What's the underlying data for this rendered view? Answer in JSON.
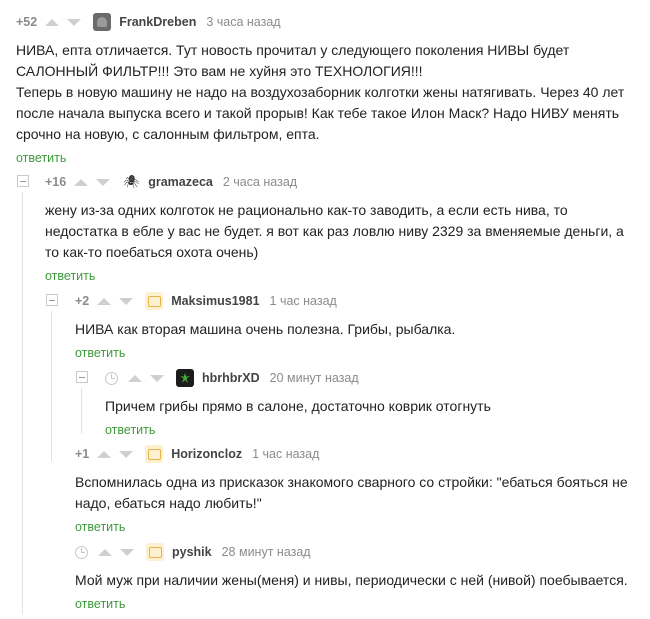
{
  "reply_label": "ответить",
  "colors": {
    "reply": "#3d9a3a",
    "muted": "#8b8b8b",
    "text": "#222222"
  },
  "comments": [
    {
      "rating": "+52",
      "author": "FrankDreben",
      "time": "3 часа назад",
      "avatar": "avatar-photo",
      "text": "НИВА, епта отличается. Тут новость прочитал у следующего поколения НИВЫ будет САЛОННЫЙ ФИЛЬТР!!! Это вам не хуйня это ТЕХНОЛОГИЯ!!!\nТеперь в новую машину не надо на воздухозаборник  колготки жены натягивать. Через 40 лет после начала выпуска всего и такой прорыв! Как тебе такое Илон Маск? Надо НИВУ менять срочно на новую, с салонным фильтром, епта."
    },
    {
      "rating": "+16",
      "author": "gramazeca",
      "time": "2 часа назад",
      "avatar": "spider-icon",
      "text": "жену из-за одних колготок не рационально как-то заводить, а если есть нива, то недостатка в ебле у вас не будет. я вот как раз ловлю ниву 2329 за вменяемые деньги, а то как-то поебаться охота очень)"
    },
    {
      "rating": "+2",
      "author": "Maksimus1981",
      "time": "1 час назад",
      "avatar": "placeholder-avatar",
      "text": "НИВА как вторая машина очень полезна. Грибы, рыбалка."
    },
    {
      "rating": "",
      "author": "hbrhbrXD",
      "time": "20 минут назад",
      "avatar": "leaf-icon",
      "text": "Причем грибы прямо в салоне, достаточно коврик отогнуть"
    },
    {
      "rating": "+1",
      "author": "Horizoncloz",
      "time": "1 час назад",
      "avatar": "placeholder-avatar",
      "text": "Вспомнилась одна из присказок знакомого сварного со стройки: \"ебаться бояться не надо, ебаться надо любить!\""
    },
    {
      "rating": "",
      "author": "pyshik",
      "time": "28 минут назад",
      "avatar": "placeholder-avatar",
      "text": "Мой муж при наличии жены(меня) и нивы, периодически с ней (нивой) поебывается."
    }
  ]
}
